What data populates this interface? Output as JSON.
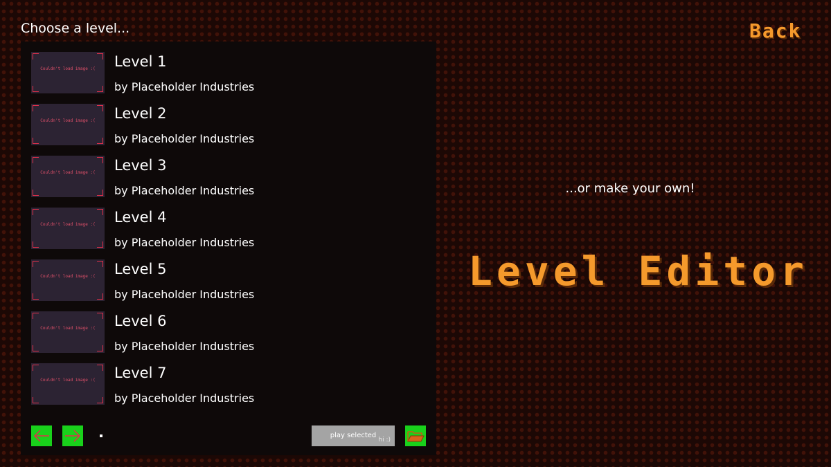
{
  "header": {
    "title": "Choose a level...",
    "back_label": "Back"
  },
  "levels": [
    {
      "name": "Level 1",
      "author": "by Placeholder Industries",
      "thumb_text": "Couldn't load image :("
    },
    {
      "name": "Level 2",
      "author": "by Placeholder Industries",
      "thumb_text": "Couldn't load image :("
    },
    {
      "name": "Level 3",
      "author": "by Placeholder Industries",
      "thumb_text": "Couldn't load image :("
    },
    {
      "name": "Level 4",
      "author": "by Placeholder Industries",
      "thumb_text": "Couldn't load image :("
    },
    {
      "name": "Level 5",
      "author": "by Placeholder Industries",
      "thumb_text": "Couldn't load image :("
    },
    {
      "name": "Level 6",
      "author": "by Placeholder Industries",
      "thumb_text": "Couldn't load image :("
    },
    {
      "name": "Level 7",
      "author": "by Placeholder Industries",
      "thumb_text": "Couldn't load image :("
    }
  ],
  "controls": {
    "prev_icon": "arrow-left-icon",
    "next_icon": "arrow-right-icon",
    "folder_icon": "folder-open-icon",
    "play_label": "play selected",
    "play_sub": "hi :)"
  },
  "editor": {
    "prompt": "...or make your own!",
    "title": "Level Editor"
  },
  "colors": {
    "background": "#1c0805",
    "panel": "#0e0909",
    "accent": "#f59a2c",
    "button_green": "#19d11b",
    "play_gray": "#a4a4a4",
    "thumb_bg": "#2c2333",
    "thumb_mark": "#e0304a"
  }
}
